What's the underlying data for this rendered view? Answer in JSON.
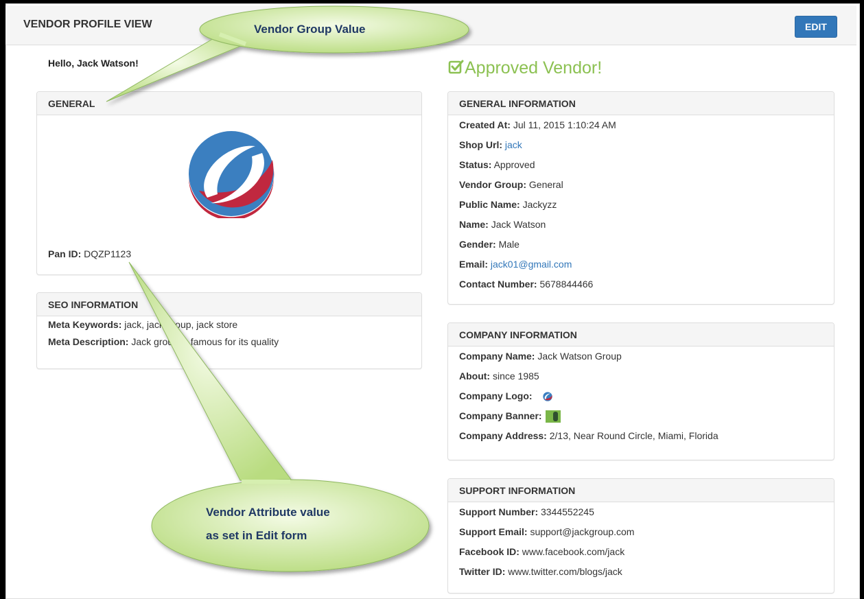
{
  "header": {
    "title": "VENDOR PROFILE VIEW",
    "edit_label": "EDIT"
  },
  "greeting": "Hello, Jack Watson!",
  "approved": {
    "label": "Approved Vendor!",
    "color": "#8cc152"
  },
  "general": {
    "heading": "GENERAL",
    "pan_label": "Pan ID:",
    "pan_value": "DQZP1123"
  },
  "seo": {
    "heading": "SEO INFORMATION",
    "keywords_label": "Meta Keywords:",
    "keywords_value": "jack, jack group, jack store",
    "description_label": "Meta Description:",
    "description_value": "Jack group is famous for its quality"
  },
  "general_info": {
    "heading": "GENERAL INFORMATION",
    "rows": [
      {
        "label": "Created At:",
        "value": "Jul 11, 2015 1:10:24 AM"
      },
      {
        "label": "Shop Url:",
        "value": "jack"
      },
      {
        "label": "Status:",
        "value": "Approved"
      },
      {
        "label": "Vendor Group:",
        "value": "General"
      },
      {
        "label": "Public Name:",
        "value": "Jackyzz"
      },
      {
        "label": "Name:",
        "value": "Jack Watson"
      },
      {
        "label": "Gender:",
        "value": "Male"
      },
      {
        "label": "Email:",
        "value": "jack01@gmail.com"
      },
      {
        "label": "Contact Number:",
        "value": "5678844466"
      }
    ]
  },
  "company_info": {
    "heading": "COMPANY INFORMATION",
    "name_label": "Company Name:",
    "name_value": "Jack Watson Group",
    "about_label": "About:",
    "about_value": "since 1985",
    "logo_label": "Company Logo:",
    "banner_label": "Company Banner:",
    "address_label": "Company Address:",
    "address_value": "2/13, Near Round Circle, Miami, Florida"
  },
  "support_info": {
    "heading": "SUPPORT INFORMATION",
    "rows": [
      {
        "label": "Support Number:",
        "value": "3344552245"
      },
      {
        "label": "Support Email:",
        "value": "support@jackgroup.com"
      },
      {
        "label": "Facebook ID:",
        "value": "www.facebook.com/jack"
      },
      {
        "label": "Twitter ID:",
        "value": "www.twitter.com/blogs/jack"
      }
    ]
  },
  "callouts": {
    "top": "Vendor Group Value",
    "bottom_line1": "Vendor Attribute value",
    "bottom_line2": "as set in Edit form",
    "fill": "#c9e59a"
  },
  "colors": {
    "accent": "#3277b9",
    "approved": "#8cc152",
    "logo_blue": "#3b7fc0",
    "logo_red": "#c0283f"
  }
}
